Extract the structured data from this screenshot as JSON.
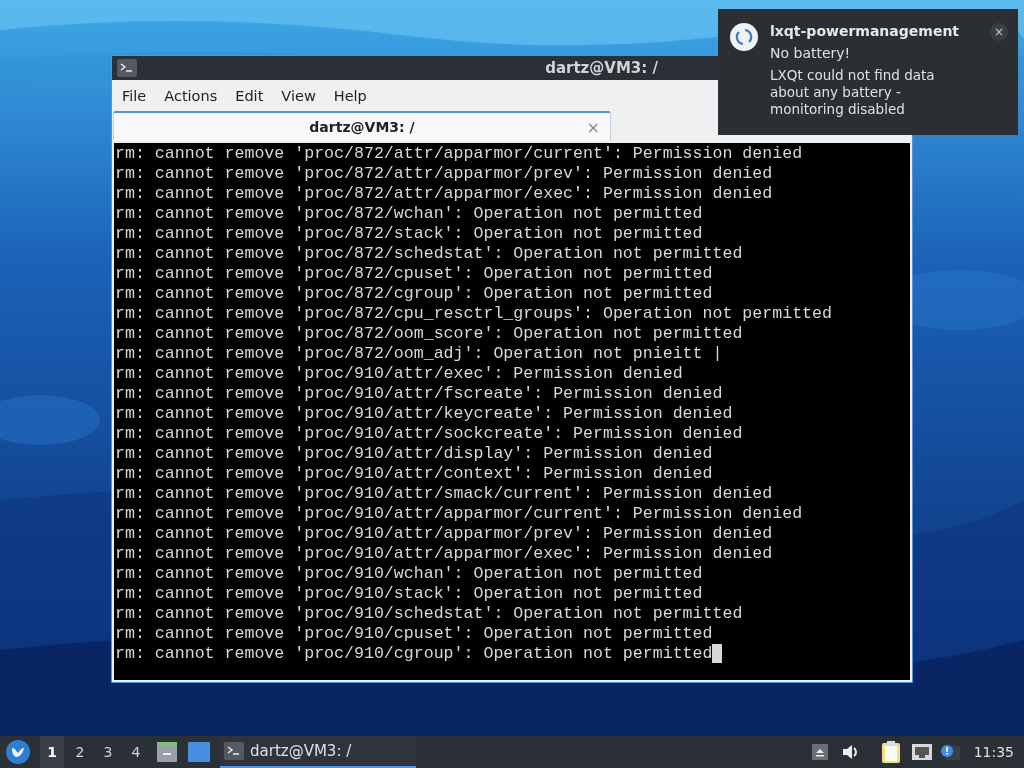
{
  "terminal_window": {
    "title": "dartz@VM3: /",
    "menu": [
      "File",
      "Actions",
      "Edit",
      "View",
      "Help"
    ],
    "tabs": [
      {
        "label": "dartz@VM3: /",
        "selected": true,
        "close": "×"
      }
    ],
    "lines": [
      "rm: cannot remove 'proc/872/attr/apparmor/current': Permission denied",
      "rm: cannot remove 'proc/872/attr/apparmor/prev': Permission denied",
      "rm: cannot remove 'proc/872/attr/apparmor/exec': Permission denied",
      "rm: cannot remove 'proc/872/wchan': Operation not permitted",
      "rm: cannot remove 'proc/872/stack': Operation not permitted",
      "rm: cannot remove 'proc/872/schedstat': Operation not permitted",
      "rm: cannot remove 'proc/872/cpuset': Operation not permitted",
      "rm: cannot remove 'proc/872/cgroup': Operation not permitted",
      "rm: cannot remove 'proc/872/cpu_resctrl_groups': Operation not permitted",
      "rm: cannot remove 'proc/872/oom_score': Operation not permitted",
      "rm: cannot remove 'proc/872/oom_adj': Operation not pnieitt |",
      "rm: cannot remove 'proc/910/attr/exec': Permission denied",
      "rm: cannot remove 'proc/910/attr/fscreate': Permission denied",
      "rm: cannot remove 'proc/910/attr/keycreate': Permission denied",
      "rm: cannot remove 'proc/910/attr/sockcreate': Permission denied",
      "rm: cannot remove 'proc/910/attr/display': Permission denied",
      "rm: cannot remove 'proc/910/attr/context': Permission denied",
      "rm: cannot remove 'proc/910/attr/smack/current': Permission denied",
      "rm: cannot remove 'proc/910/attr/apparmor/current': Permission denied",
      "rm: cannot remove 'proc/910/attr/apparmor/prev': Permission denied",
      "rm: cannot remove 'proc/910/attr/apparmor/exec': Permission denied",
      "rm: cannot remove 'proc/910/wchan': Operation not permitted",
      "rm: cannot remove 'proc/910/stack': Operation not permitted",
      "rm: cannot remove 'proc/910/schedstat': Operation not permitted",
      "rm: cannot remove 'proc/910/cpuset': Operation not permitted",
      "rm: cannot remove 'proc/910/cgroup': Operation not permitted"
    ]
  },
  "notification": {
    "app": "lxqt-powermanagement",
    "summary": "No battery!",
    "body": "LXQt could not find data about any battery - monitoring disabled",
    "close": "×"
  },
  "taskbar": {
    "workspaces": [
      {
        "label": "1",
        "selected": true
      },
      {
        "label": "2",
        "selected": false
      },
      {
        "label": "3",
        "selected": false
      },
      {
        "label": "4",
        "selected": false
      }
    ],
    "tasks": [
      {
        "label": "dartz@VM3: /",
        "selected": true
      }
    ],
    "clock": "11:35"
  }
}
